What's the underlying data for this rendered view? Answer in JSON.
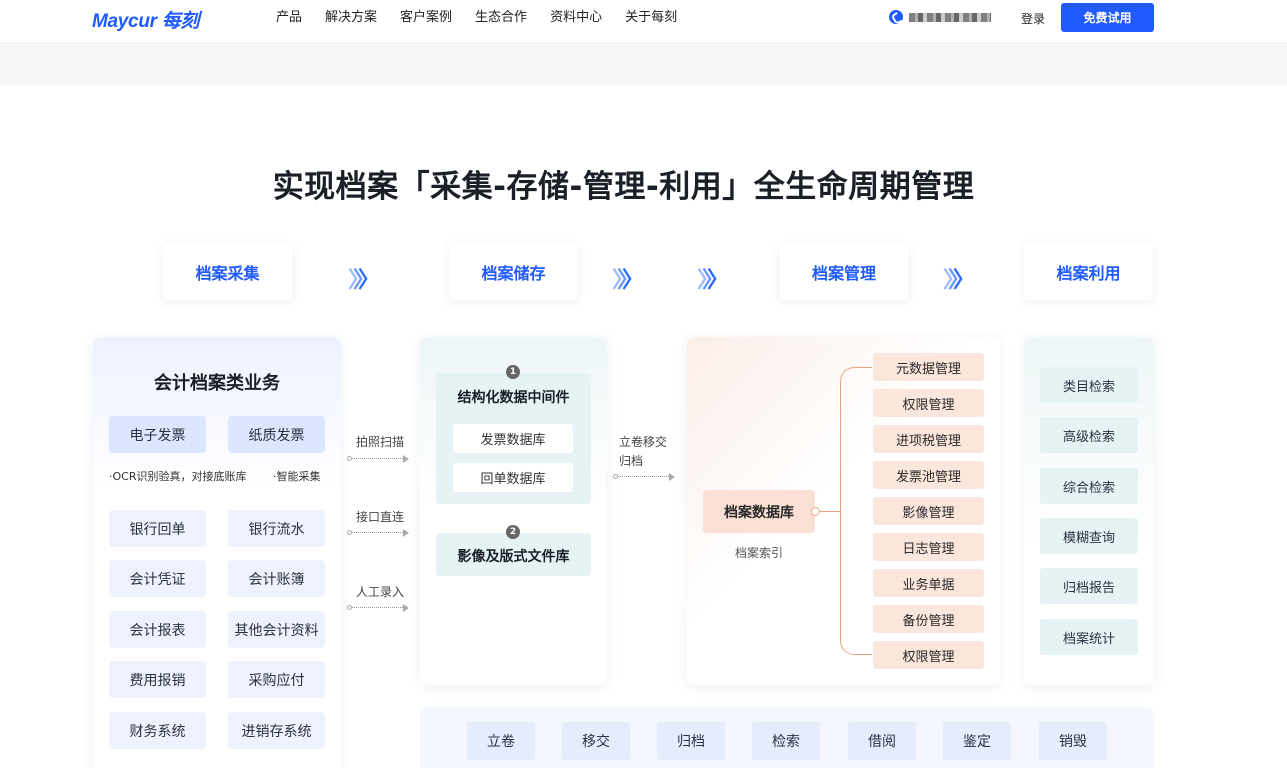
{
  "header": {
    "logo": "Maycur 每刻",
    "nav": [
      "产品",
      "解决方案",
      "客户案例",
      "生态合作",
      "资料中心",
      "关于每刻"
    ],
    "login_label": "登录",
    "trial_label": "免费试用"
  },
  "main_title": "实现档案「采集-存储-管理-利用」全生命周期管理",
  "stages": [
    "档案采集",
    "档案储存",
    "档案管理",
    "档案利用"
  ],
  "left_card": {
    "title": "会计档案类业务",
    "top_chips": [
      "电子发票",
      "纸质发票"
    ],
    "notes": [
      "·OCR识别验真，对接底账库",
      "·智能采集"
    ],
    "chips": [
      "银行回单",
      "银行流水",
      "会计凭证",
      "会计账簿",
      "会计报表",
      "其他会计资料",
      "费用报销",
      "采购应付",
      "财务系统",
      "进销存系统"
    ]
  },
  "inputs": [
    "拍照扫描",
    "接口直连",
    "人工录入"
  ],
  "storage": {
    "box1": {
      "num": "1",
      "title": "结构化数据中间件",
      "items": [
        "发票数据库",
        "回单数据库"
      ]
    },
    "box2": {
      "num": "2",
      "title": "影像及版式文件库"
    }
  },
  "transfer_label_1": "立卷移交",
  "transfer_label_2": "归档",
  "archive": {
    "db_label": "档案数据库",
    "index_label": "档案索引",
    "items": [
      "元数据管理",
      "权限管理",
      "进项税管理",
      "发票池管理",
      "影像管理",
      "日志管理",
      "业务单据",
      "备份管理",
      "权限管理"
    ]
  },
  "utilization": [
    "类目检索",
    "高级检索",
    "综合检索",
    "模糊查询",
    "归档报告",
    "档案统计"
  ],
  "lifecycle": [
    "立卷",
    "移交",
    "归档",
    "检索",
    "借阅",
    "鉴定",
    "销毁"
  ]
}
